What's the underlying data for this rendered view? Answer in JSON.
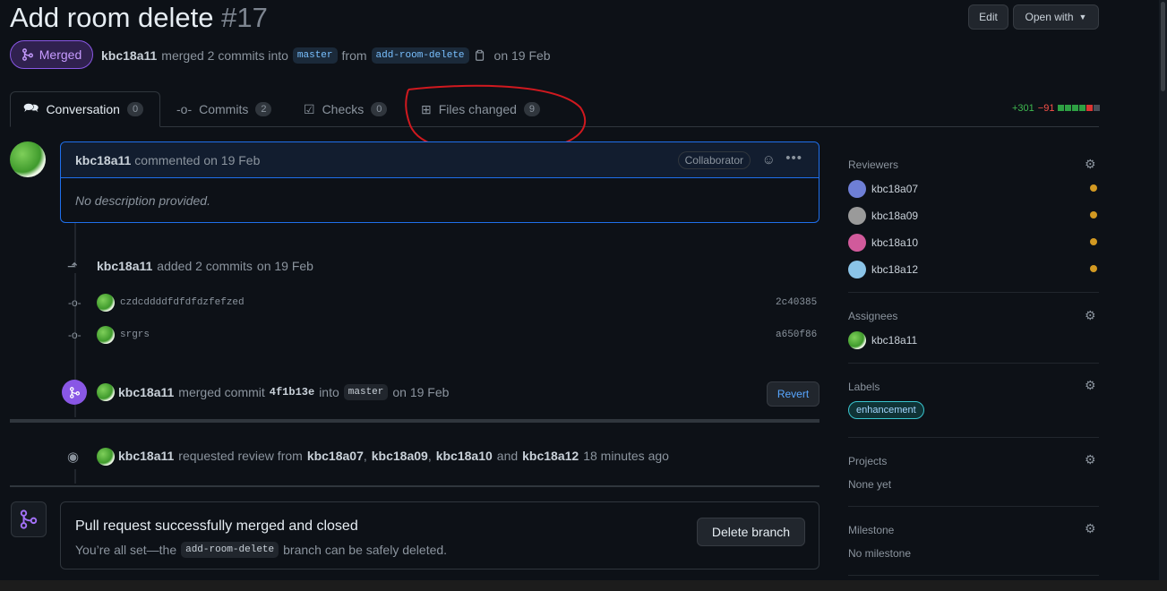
{
  "pr": {
    "title": "Add room delete",
    "number": "#17",
    "state": "Merged",
    "author": "kbc18a11",
    "merged_text": "merged 2 commits into",
    "base_branch": "master",
    "from_text": "from",
    "head_branch": "add-room-delete",
    "date_text": "on 19 Feb"
  },
  "header_buttons": {
    "edit": "Edit",
    "open_with": "Open with"
  },
  "tabs": [
    {
      "label": "Conversation",
      "count": "0"
    },
    {
      "label": "Commits",
      "count": "2"
    },
    {
      "label": "Checks",
      "count": "0"
    },
    {
      "label": "Files changed",
      "count": "9"
    }
  ],
  "diffstat": {
    "additions": "+301",
    "deletions": "−91"
  },
  "comment": {
    "author": "kbc18a11",
    "action": "commented on 19 Feb",
    "badge": "Collaborator",
    "body": "No description provided."
  },
  "timeline": {
    "added_commits": {
      "author": "kbc18a11",
      "text": "added 2 commits",
      "date": "on 19 Feb"
    },
    "commits": [
      {
        "message": "czdcddddfdfdfdzfefzed",
        "sha": "2c40385"
      },
      {
        "message": "srgrs",
        "sha": "a650f86"
      }
    ],
    "merge_event": {
      "author": "kbc18a11",
      "text": "merged commit",
      "sha": "4f1b13e",
      "into": "into",
      "branch": "master",
      "date": "on 19 Feb",
      "revert": "Revert"
    },
    "review_request": {
      "author": "kbc18a11",
      "text": "requested review from",
      "r1": "kbc18a07",
      "r2": "kbc18a09",
      "r3": "kbc18a10",
      "and": "and",
      "r4": "kbc18a12",
      "time": "18 minutes ago"
    }
  },
  "merged_box": {
    "title": "Pull request successfully merged and closed",
    "desc_prefix": "You’re all set—the",
    "branch": "add-room-delete",
    "desc_suffix": "branch can be safely deleted.",
    "button": "Delete branch"
  },
  "sidebar": {
    "reviewers_heading": "Reviewers",
    "reviewers": [
      "kbc18a07",
      "kbc18a09",
      "kbc18a10",
      "kbc18a12"
    ],
    "assignees_heading": "Assignees",
    "assignee": "kbc18a11",
    "labels_heading": "Labels",
    "label": "enhancement",
    "projects_heading": "Projects",
    "projects_value": "None yet",
    "milestone_heading": "Milestone",
    "milestone_value": "No milestone"
  },
  "annotation": {
    "color": "#d0191f",
    "target": "Files changed tab"
  },
  "colors": {
    "merged": "#8957e5",
    "accent": "#1f6feb",
    "pending": "#d29922"
  }
}
